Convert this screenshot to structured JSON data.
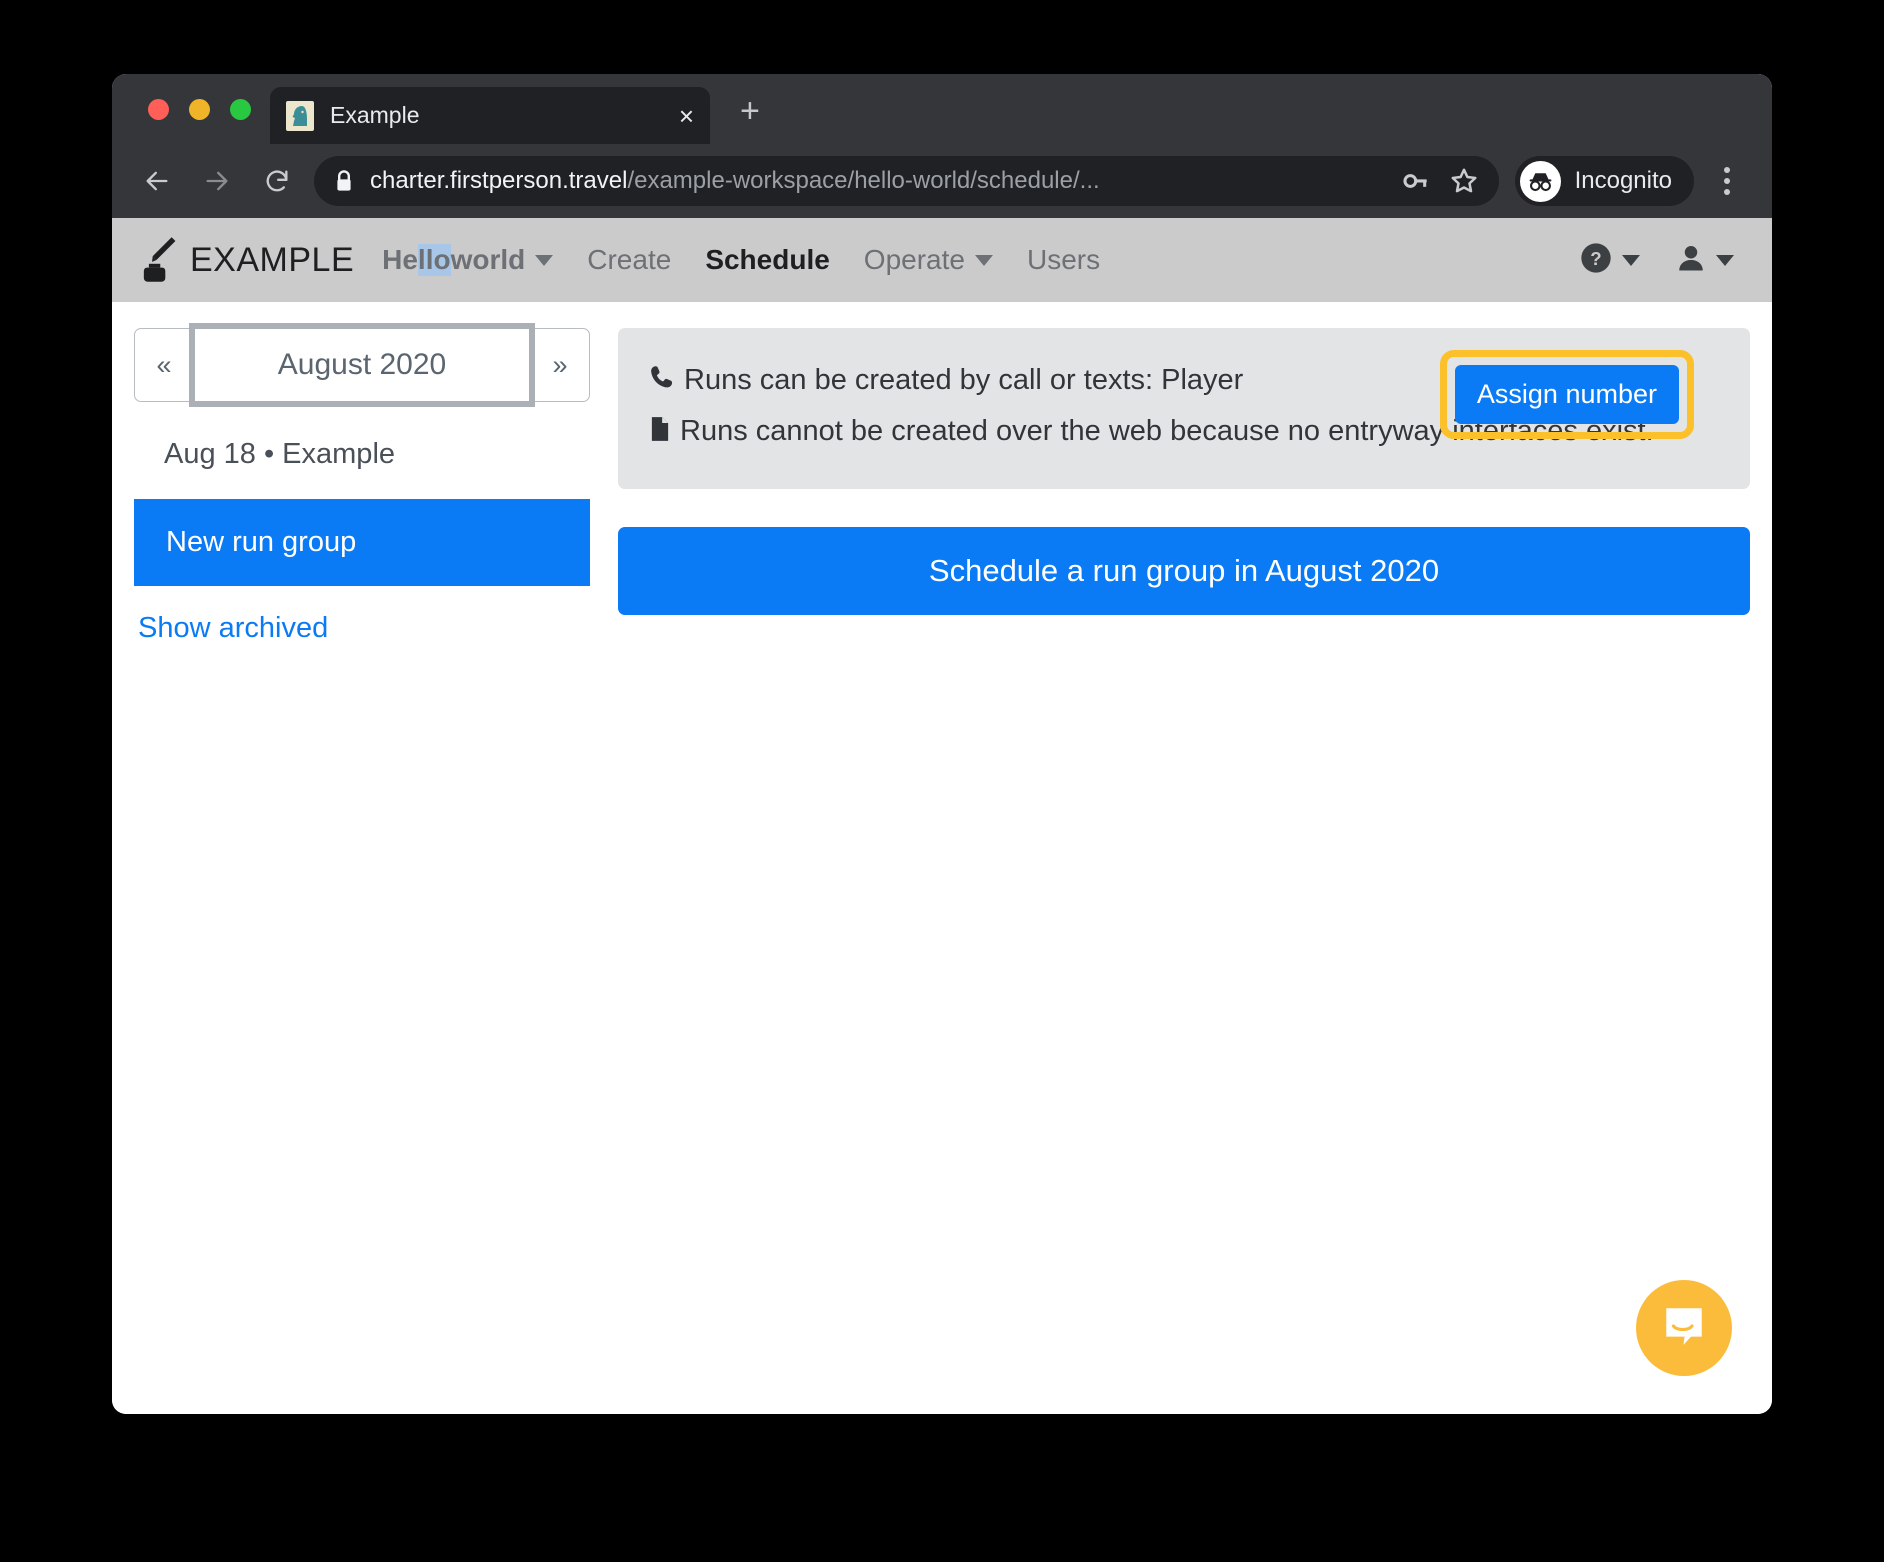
{
  "browser": {
    "tab": {
      "title": "Example",
      "favicon": "chess-knight-icon",
      "close": "×"
    },
    "new_tab": "+",
    "back": "back-arrow-icon",
    "forward": "forward-arrow-icon",
    "reload": "reload-icon",
    "url_host": "charter.firstperson.travel",
    "url_path": "/example-workspace/hello-world/schedule/...",
    "lock": "lock-icon",
    "key": "key-icon",
    "star": "star-icon",
    "incognito_label": "Incognito",
    "menu": "three-dot-menu-icon"
  },
  "app": {
    "brand": "EXAMPLE",
    "workspace": {
      "label": "Hello world",
      "selected_fragment": "llo"
    },
    "nav": [
      {
        "label": "Create",
        "state": "muted",
        "caret": false
      },
      {
        "label": "Schedule",
        "state": "active",
        "caret": false
      },
      {
        "label": "Operate",
        "state": "muted",
        "caret": true
      },
      {
        "label": "Users",
        "state": "muted",
        "caret": false
      }
    ],
    "help_icon": "help-circle-icon",
    "account_icon": "user-icon"
  },
  "sidebar": {
    "prev_month": "«",
    "next_month": "»",
    "month_label": "August 2020",
    "day_header": "Aug 18 • Example",
    "run_group": "New run group",
    "show_archived": "Show archived"
  },
  "main": {
    "alert": {
      "line1_icon": "phone-icon",
      "line1": "Runs can be created by call or texts: Player",
      "line2_icon": "document-icon",
      "line2": "Runs cannot be created over the web because no entryway interfaces exist.",
      "assign_button": "Assign number"
    },
    "cta": "Schedule a run group in August 2020",
    "chat_launcher": "chat-bubble-icon"
  },
  "colors": {
    "accent_blue": "#0b7bf5",
    "highlight_yellow": "#fcc02a",
    "chat_amber": "#fbbc3c",
    "navbar_gray": "#cbcbcb",
    "alert_gray": "#e3e4e6"
  }
}
